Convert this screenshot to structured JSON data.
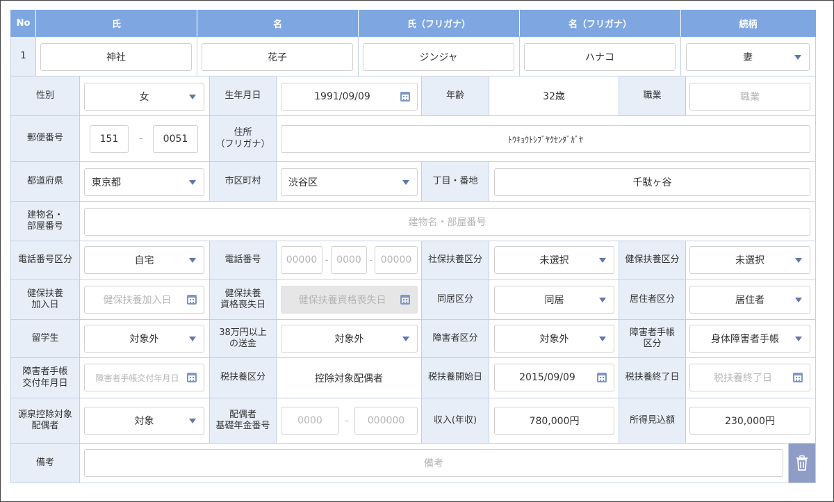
{
  "header": {
    "no": "No",
    "last_name": "氏",
    "first_name": "名",
    "last_name_kana": "氏（フリガナ）",
    "first_name_kana": "名（フリガナ）",
    "relationship": "続柄"
  },
  "row1": {
    "no": "1",
    "last_name": "神社",
    "first_name": "花子",
    "last_name_kana": "ジンジャ",
    "first_name_kana": "ハナコ",
    "relationship": "妻"
  },
  "row2": {
    "gender_label": "性別",
    "gender": "女",
    "birthdate_label": "生年月日",
    "birthdate": "1991/09/09",
    "age_label": "年齢",
    "age": "32歳",
    "occupation_label": "職業",
    "occupation_placeholder": "職業"
  },
  "row3": {
    "postal_label": "郵便番号",
    "postal_1": "151",
    "postal_sep": "–",
    "postal_2": "0051",
    "address_kana_label": "住所\n（フリガナ）",
    "address_kana": "ﾄｳｷｮｳﾄｼﾌﾞﾔｸｾﾝﾀﾞｶﾞﾔ"
  },
  "row4": {
    "prefecture_label": "都道府県",
    "prefecture": "東京都",
    "city_label": "市区町村",
    "city": "渋谷区",
    "block_label": "丁目・番地",
    "block": "千駄ヶ谷"
  },
  "row5": {
    "building_label": "建物名・\n部屋番号",
    "building_placeholder": "建物名・部屋番号"
  },
  "row6": {
    "phone_type_label": "電話番号区分",
    "phone_type": "自宅",
    "phone_label": "電話番号",
    "phone_1_placeholder": "00000",
    "phone_2_placeholder": "0000",
    "phone_3_placeholder": "00000",
    "phone_sep": "-",
    "social_dependent_label": "社保扶養区分",
    "social_dependent": "未選択",
    "health_dependent_label": "健保扶養区分",
    "health_dependent": "未選択"
  },
  "row7": {
    "health_join_label": "健保扶養\n加入日",
    "health_join_placeholder": "健保扶養加入日",
    "health_loss_label": "健保扶養\n資格喪失日",
    "health_loss_placeholder": "健保扶養資格喪失日",
    "cohabitation_label": "同居区分",
    "cohabitation": "同居",
    "residency_label": "居住者区分",
    "residency": "居住者"
  },
  "row8": {
    "student_label": "留学生",
    "student": "対象外",
    "remittance_label": "38万円以上\nの送金",
    "remittance": "対象外",
    "disability_label": "障害者区分",
    "disability": "対象外",
    "disability_book_label": "障害者手帳\n区分",
    "disability_book": "身体障害者手帳"
  },
  "row9": {
    "book_issue_label": "障害者手帳\n交付年月日",
    "book_issue_placeholder": "障害者手帳交付年月日",
    "tax_dependent_label": "税扶養区分",
    "tax_dependent": "控除対象配偶者",
    "tax_start_label": "税扶養開始日",
    "tax_start": "2015/09/09",
    "tax_end_label": "税扶養終了日",
    "tax_end_placeholder": "税扶養終了日"
  },
  "row10": {
    "withholding_label": "源泉控除対象\n配偶者",
    "withholding": "対象",
    "pension_label": "配偶者\n基礎年金番号",
    "pension_1_placeholder": "0000",
    "pension_sep": "–",
    "pension_2_placeholder": "000000",
    "income_label": "収入(年収)",
    "income": "780,000円",
    "expected_income_label": "所得見込額",
    "expected_income": "230,000円"
  },
  "row11": {
    "remarks_label": "備考",
    "remarks_placeholder": "備考"
  },
  "colors": {
    "header_bg": "#7ea7e2",
    "label_bg": "#e7eef8",
    "border": "#c3d0e0",
    "trash_bg": "#8f9cc6",
    "caret": "#5f79a8"
  }
}
